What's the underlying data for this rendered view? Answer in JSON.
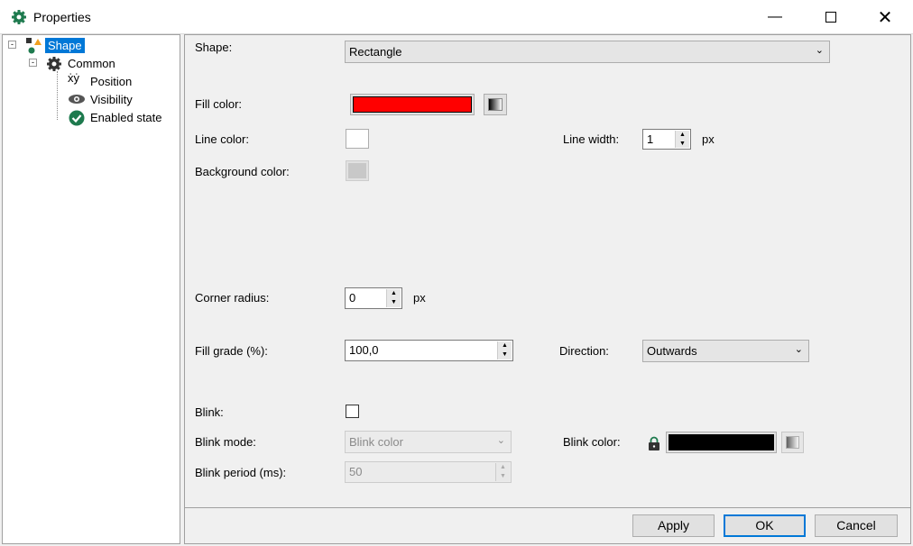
{
  "window": {
    "title": "Properties",
    "icon": "gear-icon"
  },
  "tree": {
    "items": [
      {
        "label": "Shape",
        "icon": "shape-icon"
      },
      {
        "label": "Common",
        "icon": "gear-icon"
      },
      {
        "label": "Position",
        "icon": "xy-position-icon"
      },
      {
        "label": "Visibility",
        "icon": "eye-icon"
      },
      {
        "label": "Enabled state",
        "icon": "check-circle-icon"
      }
    ]
  },
  "form": {
    "shape": {
      "label": "Shape:",
      "value": "Rectangle"
    },
    "fill_color": {
      "label": "Fill color:",
      "color": "#ff0000"
    },
    "line_color": {
      "label": "Line color:",
      "color": "#ffffff"
    },
    "line_width": {
      "label": "Line width:",
      "value": "1",
      "unit": "px"
    },
    "background_color": {
      "label": "Background color:",
      "color": "#c8c8c8"
    },
    "corner_radius": {
      "label": "Corner radius:",
      "value": "0",
      "unit": "px"
    },
    "fill_grade": {
      "label": "Fill grade (%):",
      "value": "100,0"
    },
    "direction": {
      "label": "Direction:",
      "value": "Outwards"
    },
    "blink": {
      "label": "Blink:",
      "checked": false
    },
    "blink_mode": {
      "label": "Blink mode:",
      "value": "Blink color"
    },
    "blink_color": {
      "label": "Blink color:",
      "color": "#000000"
    },
    "blink_period": {
      "label": "Blink period (ms):",
      "value": "50"
    }
  },
  "buttons": {
    "apply": "Apply",
    "ok": "OK",
    "cancel": "Cancel"
  },
  "colors": {
    "selection": "#0078d7",
    "accent_green": "#1e7a4e"
  }
}
